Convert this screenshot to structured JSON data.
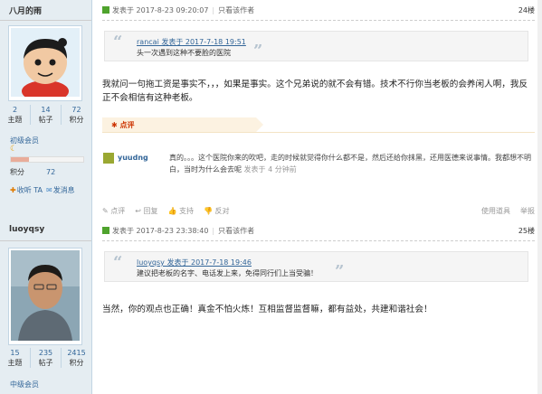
{
  "post1": {
    "username": "八月的雨",
    "stats": [
      {
        "num": "2",
        "label": "主题"
      },
      {
        "num": "14",
        "label": "帖子"
      },
      {
        "num": "72",
        "label": "积分"
      }
    ],
    "level": "初级会员",
    "level_progress": 0.25,
    "jifen_label": "积分",
    "jifen_value": "72",
    "follow_label": "收听 TA",
    "message_label": "发消息",
    "header": {
      "posted": "发表于 2017-8-23 09:20:07",
      "only_author": "只看该作者",
      "floor": "24楼"
    },
    "quote": {
      "head": "rancai 发表于 2017-7-18 19:51",
      "body": "头一次遇到这种不要脸的医院"
    },
    "message": "我就问一句拖工资是事实不，，，如果是事实。这个兄弟说的就不会有错。技术不行你当老板的会养闲人啊，我反正不会相信有这种老板。",
    "rating_label": "点评",
    "rater": "yuudng",
    "rating_text": "真的。。。这个医院你来的吹吧，走的时候就觉得你什么都不是，然后还给你抹黑，还用医德来说事情。我都想不明白，当时为什么会去呢",
    "rating_time": "发表于 4 分钟前",
    "footer": [
      "点评",
      "回复",
      "支持",
      "反对"
    ],
    "footer_right": [
      "使用道具",
      "举报"
    ]
  },
  "post2": {
    "username": "luoyqsy",
    "stats": [
      {
        "num": "15",
        "label": "主题"
      },
      {
        "num": "235",
        "label": "帖子"
      },
      {
        "num": "2415",
        "label": "积分"
      }
    ],
    "level": "中级会员",
    "header": {
      "posted": "发表于 2017-8-23 23:38:40",
      "only_author": "只看该作者",
      "floor": "25楼"
    },
    "quote": {
      "head": "luoyqsy 发表于 2017-7-18 19:46",
      "body": "建议把老板的名字、电话发上来，免得同行们上当受骗！"
    },
    "message": "当然，你的观点也正确！真金不怕火炼！互相监督监督嘛，都有益处，共建和谐社会！"
  },
  "colors": {
    "accent": "#336699",
    "sidebar": "#e5edf2",
    "rating": "#fcf2e1"
  }
}
